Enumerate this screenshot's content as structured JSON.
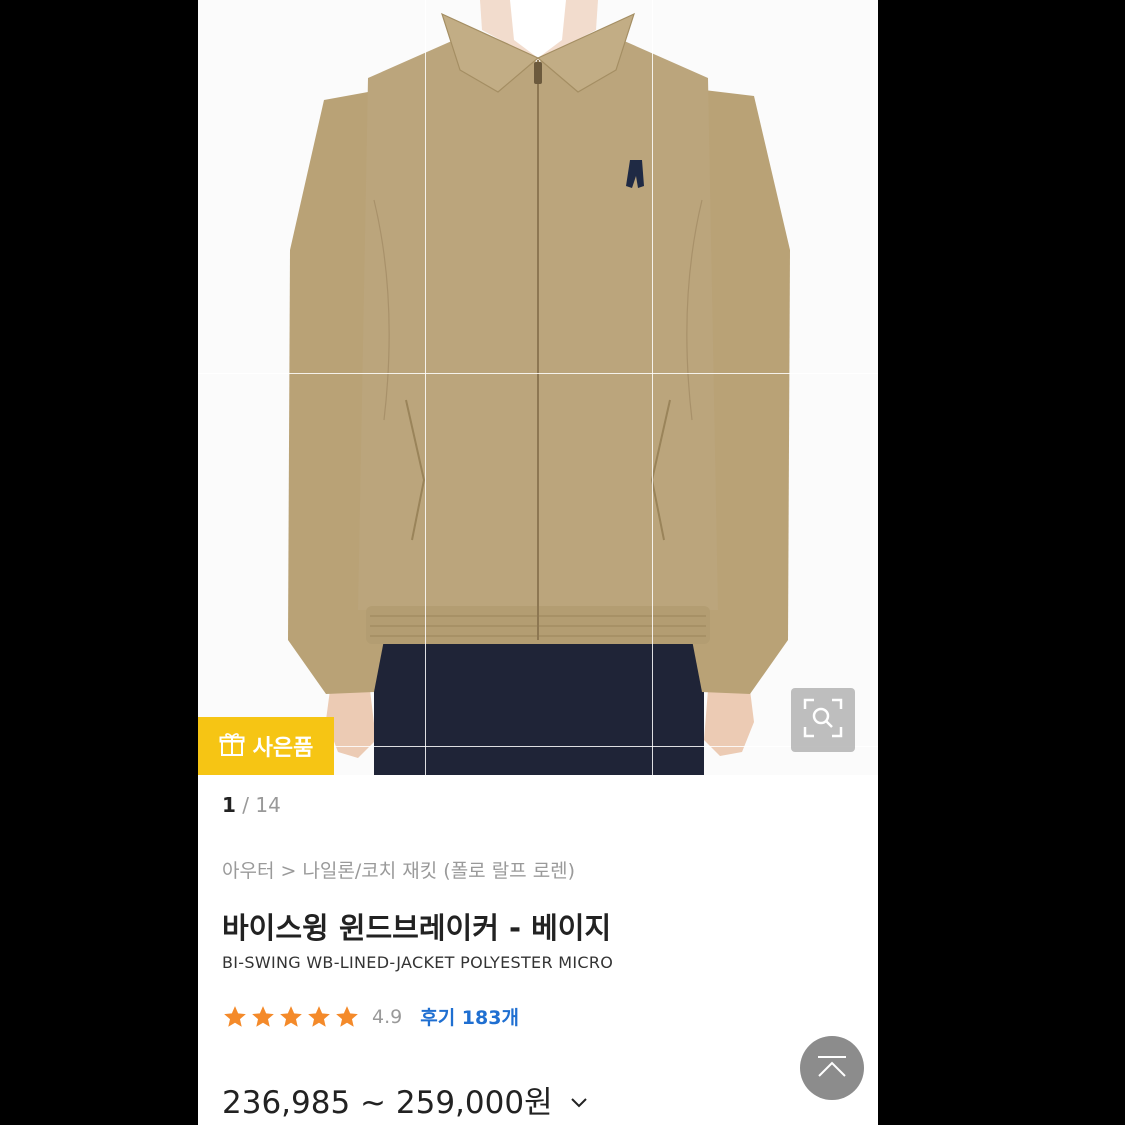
{
  "gallery": {
    "gift_badge": "사은품",
    "page_current": "1",
    "page_separator": "/",
    "page_total": "14"
  },
  "product": {
    "breadcrumb": "아우터 > 나일론/코치 재킷 (폴로 랄프 로렌)",
    "title_ko": "바이스윙 윈드브레이커 - 베이지",
    "title_en": "BI-SWING WB-LINED-JACKET POLYESTER MICRO",
    "rating_stars": 5,
    "rating_value": "4.9",
    "review_label": "후기 183개",
    "price": "236,985 ~ 259,000원"
  },
  "icons": {
    "gift": "gift-icon",
    "zoom": "zoom-icon",
    "star": "star-icon",
    "chevron": "chevron-down-icon",
    "scroll_top": "scroll-top-icon"
  },
  "colors": {
    "gift_badge": "#f6c514",
    "star": "#f48a2a",
    "review_link": "#1f6fd1",
    "jacket": "#bba57c",
    "pants": "#1f2437"
  }
}
